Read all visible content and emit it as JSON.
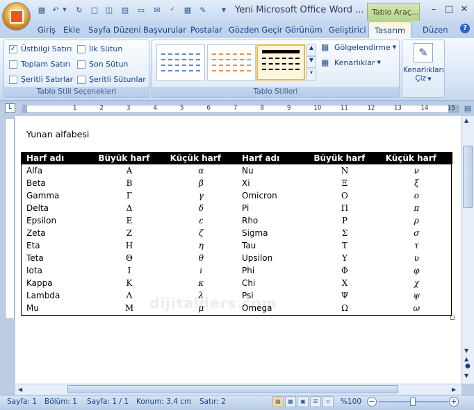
{
  "titlebar": {
    "title": "Yeni Microsoft Office Word ...",
    "context_tab": "Tablo Araç...",
    "minimize": "–",
    "maximize": "□",
    "close": "✕"
  },
  "tabs": [
    "Giriş",
    "Ekle",
    "Sayfa Düzeni",
    "Başvurular",
    "Postalar",
    "Gözden Geçir",
    "Görünüm",
    "Geliştirici",
    "Tasarım",
    "Düzen"
  ],
  "ribbon": {
    "style_options": {
      "label": "Tablo Stili Seçenekleri",
      "items": [
        {
          "label": "Üstbilgi Satırı",
          "checked": true
        },
        {
          "label": "İlk Sütun",
          "checked": false
        },
        {
          "label": "Toplam Satırı",
          "checked": false
        },
        {
          "label": "Son Sütun",
          "checked": false
        },
        {
          "label": "Şeritli Satırlar",
          "checked": false
        },
        {
          "label": "Şeritli Sütunlar",
          "checked": false
        }
      ]
    },
    "table_styles": {
      "label": "Tablo Stilleri",
      "shading": "Gölgelendirme",
      "borders": "Kenarlıklar"
    },
    "draw_borders": {
      "label1": "Kenarlıkları",
      "label2": "Çiz"
    }
  },
  "document": {
    "heading": "Yunan alfabesi",
    "headers": [
      "Harf adı",
      "Büyük harf",
      "Küçük harf",
      "Harf adı",
      "Büyük harf",
      "Küçük harf"
    ],
    "rows": [
      [
        "Alfa",
        "Α",
        "α",
        "Nu",
        "Ν",
        "ν"
      ],
      [
        "Beta",
        "Β",
        "β",
        "Xi",
        "Ξ",
        "ξ"
      ],
      [
        "Gamma",
        "Γ",
        "γ",
        "Omicron",
        "Ο",
        "ο"
      ],
      [
        "Delta",
        "Δ",
        "δ",
        "Pi",
        "Π",
        "π"
      ],
      [
        "Epsilon",
        "Ε",
        "ε",
        "Rho",
        "Ρ",
        "ρ"
      ],
      [
        "Zeta",
        "Ζ",
        "ζ",
        "Sigma",
        "Σ",
        "σ"
      ],
      [
        "Eta",
        "Η",
        "η",
        "Tau",
        "Τ",
        "τ"
      ],
      [
        "Teta",
        "Θ",
        "θ",
        "Upsilon",
        "Υ",
        "υ"
      ],
      [
        "Iota",
        "Ι",
        "ι",
        "Phi",
        "Φ",
        "φ"
      ],
      [
        "Kappa",
        "Κ",
        "κ",
        "Chi",
        "Χ",
        "χ"
      ],
      [
        "Lambda",
        "Λ",
        "λ",
        "Psi",
        "Ψ",
        "ψ"
      ],
      [
        "Mu",
        "Μ",
        "μ",
        "Omega",
        "Ω",
        "ω"
      ]
    ],
    "watermark": "dijitalders.com"
  },
  "ruler": {
    "numbers": [
      "1",
      "2",
      "3",
      "4",
      "5",
      "6",
      "7",
      "8",
      "9",
      "10",
      "11",
      "12",
      "13",
      "14",
      "15",
      "16"
    ]
  },
  "statusbar": {
    "page": "Sayfa: 1",
    "section": "Bölüm: 1",
    "pages": "Sayfa: 1 / 1",
    "position": "Konum: 3,4 cm",
    "line": "Satır: 2",
    "zoom": "%100"
  }
}
